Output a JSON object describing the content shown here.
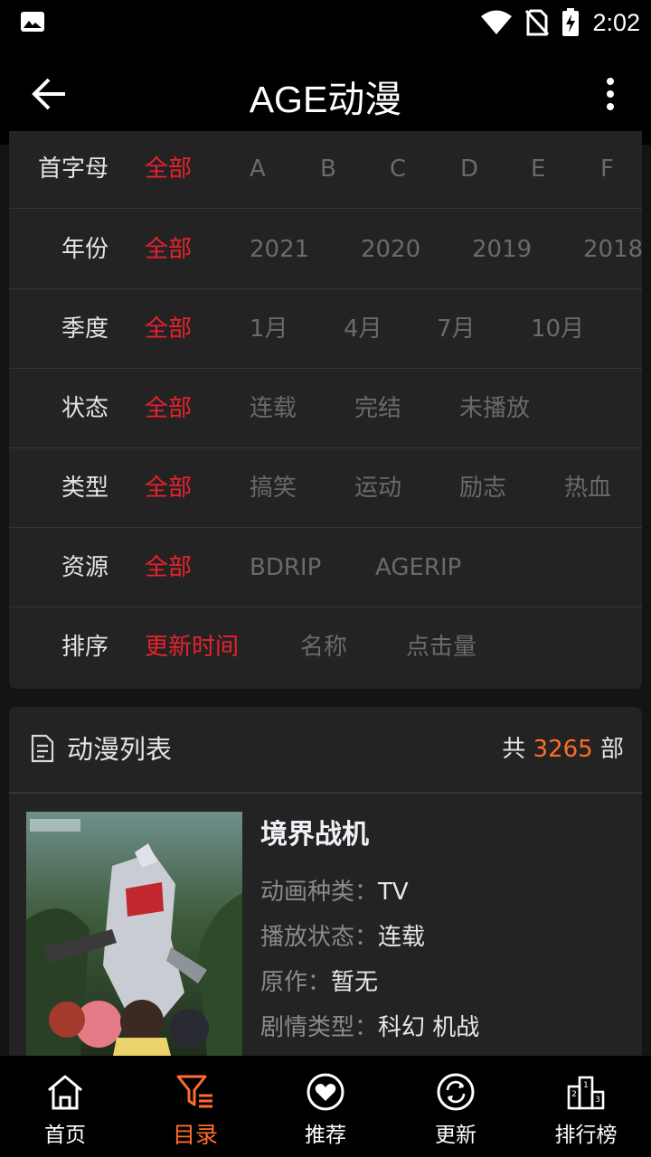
{
  "status_bar": {
    "time": "2:02"
  },
  "app_bar": {
    "title": "AGE动漫"
  },
  "filters": [
    {
      "label": "首字母",
      "options": [
        "全部",
        "A",
        "B",
        "C",
        "D",
        "E",
        "F"
      ],
      "selected": 0
    },
    {
      "label": "年份",
      "options": [
        "全部",
        "2021",
        "2020",
        "2019",
        "2018"
      ],
      "selected": 0
    },
    {
      "label": "季度",
      "options": [
        "全部",
        "1月",
        "4月",
        "7月",
        "10月"
      ],
      "selected": 0
    },
    {
      "label": "状态",
      "options": [
        "全部",
        "连载",
        "完结",
        "未播放"
      ],
      "selected": 0
    },
    {
      "label": "类型",
      "options": [
        "全部",
        "搞笑",
        "运动",
        "励志",
        "热血"
      ],
      "selected": 0
    },
    {
      "label": "资源",
      "options": [
        "全部",
        "BDRIP",
        "AGERIP"
      ],
      "selected": 0
    },
    {
      "label": "排序",
      "options": [
        "更新时间",
        "名称",
        "点击量"
      ],
      "selected": 0
    }
  ],
  "anime_list": {
    "title": "动漫列表",
    "count_prefix": "共",
    "count": "3265",
    "count_suffix": "部",
    "items": [
      {
        "title": "境界战机",
        "meta": [
          {
            "key": "动画种类：",
            "value": "TV"
          },
          {
            "key": "播放状态：",
            "value": "连载"
          },
          {
            "key": "原作：",
            "value": "暂无"
          },
          {
            "key": "剧情类型：",
            "value": "科幻 机战"
          }
        ]
      }
    ]
  },
  "bottom_nav": {
    "items": [
      {
        "label": "首页",
        "icon": "home-icon"
      },
      {
        "label": "目录",
        "icon": "filter-list-icon"
      },
      {
        "label": "推荐",
        "icon": "heart-icon"
      },
      {
        "label": "更新",
        "icon": "refresh-icon"
      },
      {
        "label": "排行榜",
        "icon": "podium-icon"
      }
    ],
    "active_index": 1
  },
  "colors": {
    "active": "#e8222d",
    "accent": "#ff6d2a",
    "background": "#141414",
    "card": "#232323"
  }
}
